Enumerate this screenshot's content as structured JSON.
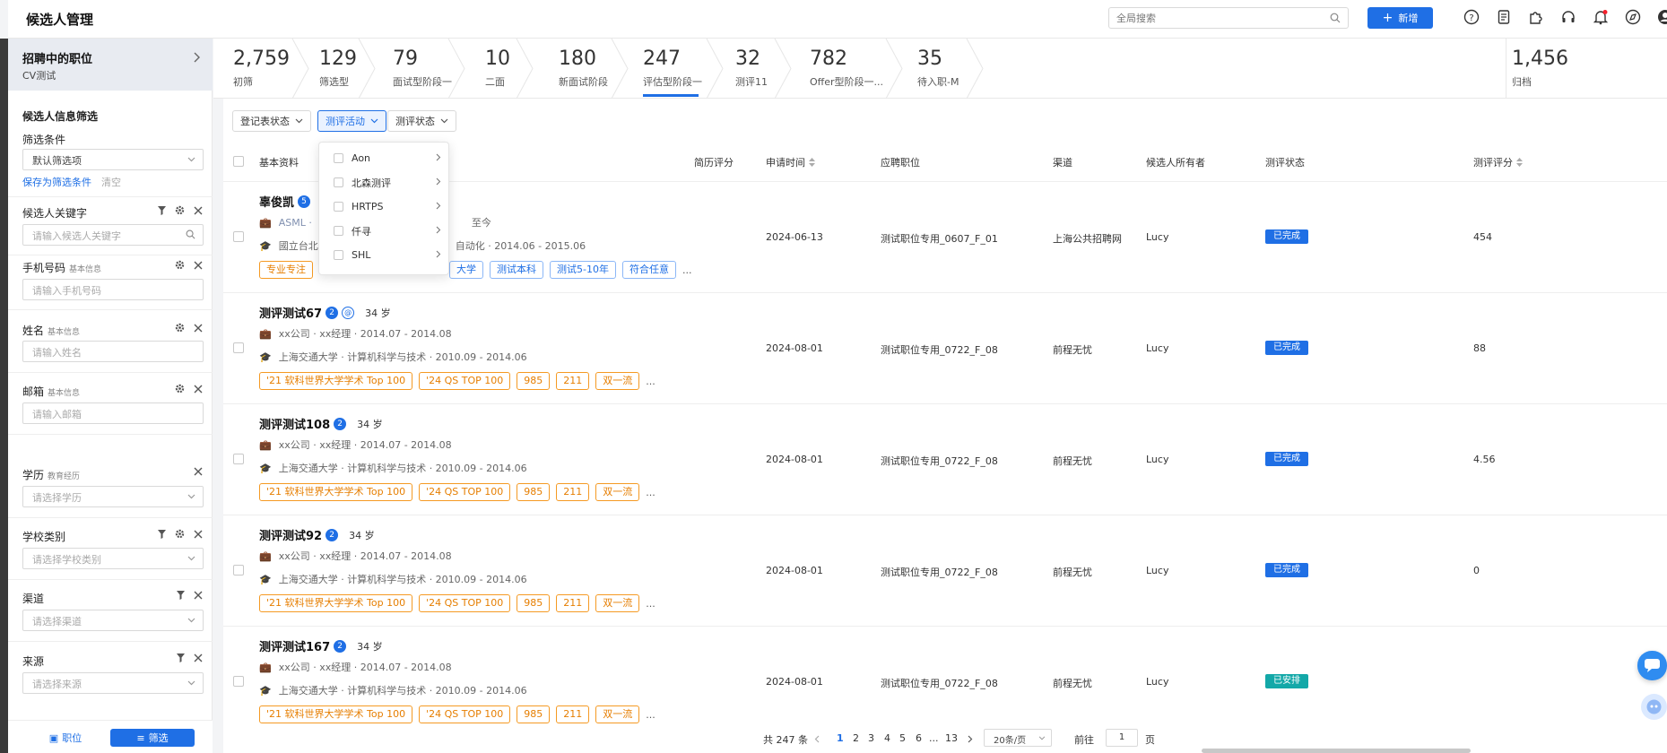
{
  "header": {
    "title": "候选人管理",
    "search_placeholder": "全局搜索",
    "add_label": "新增"
  },
  "sidebar": {
    "job_title": "招聘中的职位",
    "job_sub": "CV测试",
    "info_filter_heading": "候选人信息筛选",
    "filter_conditions_label": "筛选条件",
    "default_filter_value": "默认筛选项",
    "save_filter_label": "保存为筛选条件",
    "clear_label": "清空",
    "filters": [
      {
        "label": "候选人关键字",
        "sub": "",
        "placeholder": "请输入候选人关键字"
      },
      {
        "label": "手机号码",
        "sub": "基本信息",
        "placeholder": "请输入手机号码"
      },
      {
        "label": "姓名",
        "sub": "基本信息",
        "placeholder": "请输入姓名"
      },
      {
        "label": "邮箱",
        "sub": "基本信息",
        "placeholder": "请输入邮箱"
      },
      {
        "label": "学历",
        "sub": "教育经历",
        "placeholder": "请选择学历"
      },
      {
        "label": "学校类别",
        "sub": "",
        "placeholder": "请选择学校类别"
      },
      {
        "label": "渠道",
        "sub": "",
        "placeholder": "请选择渠道"
      },
      {
        "label": "来源",
        "sub": "",
        "placeholder": "请选择来源"
      }
    ],
    "bottom_position_label": "职位",
    "bottom_filter_label": "筛选"
  },
  "stages": [
    {
      "num": "2,759",
      "label": "初筛"
    },
    {
      "num": "129",
      "label": "筛选型"
    },
    {
      "num": "79",
      "label": "面试型阶段一"
    },
    {
      "num": "10",
      "label": "二面"
    },
    {
      "num": "180",
      "label": "新面试阶段"
    },
    {
      "num": "247",
      "label": "评估型阶段一"
    },
    {
      "num": "32",
      "label": "测评11"
    },
    {
      "num": "782",
      "label": "Offer型阶段一..."
    },
    {
      "num": "35",
      "label": "待入职-M"
    },
    {
      "num": "1,456",
      "label": "归档"
    }
  ],
  "filter_buttons": [
    "登记表状态",
    "测评活动",
    "测评状态"
  ],
  "dropdown_items": [
    "Aon",
    "北森测评",
    "HRTPS",
    "仟寻",
    "SHL"
  ],
  "table": {
    "headers": {
      "basic": "基本资料",
      "resume_score": "简历评分",
      "apply_time": "申请时间",
      "position": "应聘职位",
      "channel": "渠道",
      "owner": "候选人所有者",
      "eval_status": "测评状态",
      "eval_score": "测评评分"
    },
    "rows": [
      {
        "name": "辜俊凯",
        "badge": "5",
        "age": "",
        "work": "ASML ·",
        "work_tail": "至今",
        "edu": "國立台北",
        "edu_tail": "自动化 · 2014.06 - 2015.06",
        "tags": [
          "专业专注",
          "大学",
          "测试本科",
          "测试5-10年",
          "符合任意"
        ],
        "more": "...",
        "apply_time": "2024-06-13",
        "position": "测试职位专用_0607_F_01",
        "channel": "上海公共招聘网",
        "owner": "Lucy",
        "status": "已完成",
        "score": "454"
      },
      {
        "name": "测评测试67",
        "badge": "2",
        "age": "34 岁",
        "work": "xx公司 · xx经理 · 2014.07 - 2014.08",
        "edu": "上海交通大学 · 计算机科学与技术 · 2010.09 - 2014.06",
        "tags": [
          "'21 软科世界大学学术 Top 100",
          "'24 QS TOP 100",
          "985",
          "211",
          "双一流"
        ],
        "more": "...",
        "apply_time": "2024-08-01",
        "position": "测试职位专用_0722_F_08",
        "channel": "前程无忧",
        "owner": "Lucy",
        "status": "已完成",
        "score": "88"
      },
      {
        "name": "测评测试108",
        "badge": "2",
        "age": "34 岁",
        "work": "xx公司 · xx经理 · 2014.07 - 2014.08",
        "edu": "上海交通大学 · 计算机科学与技术 · 2010.09 - 2014.06",
        "tags": [
          "'21 软科世界大学学术 Top 100",
          "'24 QS TOP 100",
          "985",
          "211",
          "双一流"
        ],
        "more": "...",
        "apply_time": "2024-08-01",
        "position": "测试职位专用_0722_F_08",
        "channel": "前程无忧",
        "owner": "Lucy",
        "status": "已完成",
        "score": "4.56"
      },
      {
        "name": "测评测试92",
        "badge": "2",
        "age": "34 岁",
        "work": "xx公司 · xx经理 · 2014.07 - 2014.08",
        "edu": "上海交通大学 · 计算机科学与技术 · 2010.09 - 2014.06",
        "tags": [
          "'21 软科世界大学学术 Top 100",
          "'24 QS TOP 100",
          "985",
          "211",
          "双一流"
        ],
        "more": "...",
        "apply_time": "2024-08-01",
        "position": "测试职位专用_0722_F_08",
        "channel": "前程无忧",
        "owner": "Lucy",
        "status": "已完成",
        "score": "0"
      },
      {
        "name": "测评测试167",
        "badge": "2",
        "age": "34 岁",
        "work": "xx公司 · xx经理 · 2014.07 - 2014.08",
        "edu": "上海交通大学 · 计算机科学与技术 · 2010.09 - 2014.06",
        "tags": [
          "'21 软科世界大学学术 Top 100",
          "'24 QS TOP 100",
          "985",
          "211",
          "双一流"
        ],
        "more": "...",
        "apply_time": "2024-08-01",
        "position": "测试职位专用_0722_F_08",
        "channel": "前程无忧",
        "owner": "Lucy",
        "status": "已安排",
        "score": ""
      }
    ]
  },
  "pagination": {
    "total": "共 247 条",
    "pages": [
      "1",
      "2",
      "3",
      "4",
      "5",
      "6",
      "...",
      "13"
    ],
    "current": "1",
    "page_size": "20条/页",
    "goto_label": "前往",
    "goto_value": "1",
    "page_unit": "页"
  },
  "colors": {
    "accent": "#1f6fe5",
    "tag_orange": "#f59a23",
    "status_done": "#1f6fe5",
    "status_arranged": "#13a8a8"
  }
}
